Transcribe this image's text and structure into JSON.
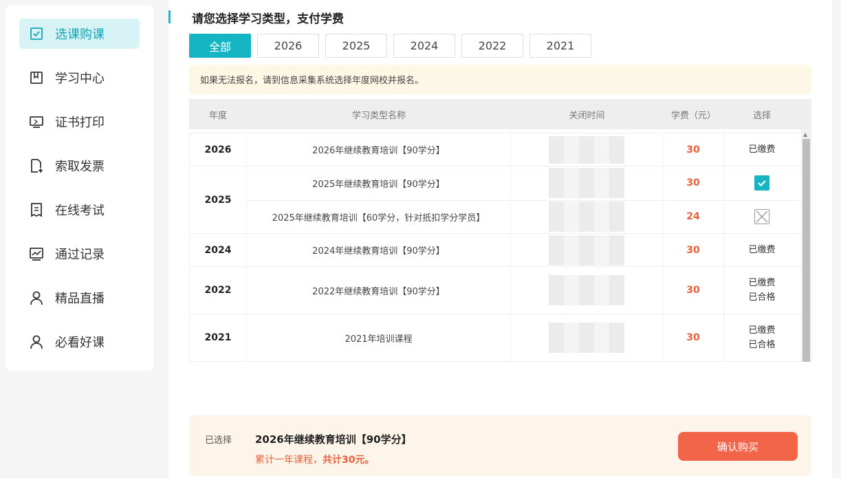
{
  "sidebar": {
    "items": [
      {
        "label": "选课购课",
        "icon": "checkbox-icon",
        "active": true
      },
      {
        "label": "学习中心",
        "icon": "book-icon",
        "active": false
      },
      {
        "label": "证书打印",
        "icon": "monitor-icon",
        "active": false
      },
      {
        "label": "索取发票",
        "icon": "file-add-icon",
        "active": false
      },
      {
        "label": "在线考试",
        "icon": "document-icon",
        "active": false
      },
      {
        "label": "通过记录",
        "icon": "chart-icon",
        "active": false
      },
      {
        "label": "精品直播",
        "icon": "user-icon",
        "active": false
      },
      {
        "label": "必看好课",
        "icon": "user-icon",
        "active": false
      }
    ]
  },
  "main": {
    "title": "请您选择学习类型，支付学费",
    "year_tabs": [
      "全部",
      "2026",
      "2025",
      "2024",
      "2022",
      "2021"
    ],
    "active_tab": "全部",
    "notice": "如果无法报名，请到信息采集系统选择年度网校并报名。",
    "table": {
      "headers": [
        "年度",
        "学习类型名称",
        "关闭时间",
        "学费（元）",
        "选择"
      ],
      "groups": [
        {
          "year": "2026",
          "rows": [
            {
              "name": "2026年继续教育培训【90学分】",
              "fee": "30",
              "status": [
                "已缴费"
              ]
            }
          ]
        },
        {
          "year": "2025",
          "rows": [
            {
              "name": "2025年继续教育培训【90学分】",
              "fee": "30",
              "status": "checked"
            },
            {
              "name": "2025年继续教育培训【60学分，针对抵扣学分学员】",
              "fee": "24",
              "status": "disabled"
            }
          ]
        },
        {
          "year": "2024",
          "rows": [
            {
              "name": "2024年继续教育培训【90学分】",
              "fee": "30",
              "status": [
                "已缴费"
              ]
            }
          ]
        },
        {
          "year": "2022",
          "rows": [
            {
              "name": "2022年继续教育培训【90学分】",
              "fee": "30",
              "status": [
                "已缴费",
                "已合格"
              ]
            }
          ]
        },
        {
          "year": "2021",
          "rows": [
            {
              "name": "2021年培训课程",
              "fee": "30",
              "status": [
                "已缴费",
                "已合格"
              ]
            }
          ]
        }
      ]
    },
    "bottom": {
      "selected_label": "已选择",
      "selected_course": "2026年继续教育培训【90学分】",
      "summary_prefix": "累计一年课程，",
      "summary_total": "共计30元。",
      "confirm_label": "确认购买"
    }
  },
  "colors": {
    "accent": "#15b5c4",
    "fee": "#e8603c",
    "confirm": "#f26549",
    "notice_bg": "#fdf7e6"
  }
}
